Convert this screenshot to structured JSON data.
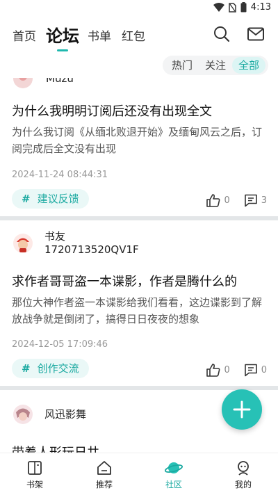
{
  "status_bar": {
    "time": "4:13"
  },
  "top_nav": {
    "tabs": [
      {
        "label": "首页"
      },
      {
        "label": "论坛"
      },
      {
        "label": "书单"
      },
      {
        "label": "红包"
      }
    ],
    "active_tab": "论坛",
    "icons": [
      "search-icon",
      "mail-icon"
    ]
  },
  "filter": {
    "items": [
      {
        "label": "热门"
      },
      {
        "label": "关注"
      },
      {
        "label": "全部"
      }
    ],
    "active": "全部"
  },
  "posts": [
    {
      "author": "Muzu",
      "title": "为什么我明明订阅后还没有出现全文",
      "body": "为什么我订阅《从缅北败退开始》及缅甸风云之后，订阅完成后全文没有出现",
      "time": "2024-11-24 08:44:31",
      "tag": "建议反馈",
      "likes": "0",
      "comments": "3"
    },
    {
      "author_line1": "书友",
      "author_line2": "1720713520QV1F",
      "title": "求作者哥哥盗一本谍影，作者是腾什么的",
      "body": "那位大神作者盗一本谍影给我们看看，这边谍影到了解放战争就是倒闭了，搞得日日夜夜的想象",
      "time": "2024-12-05 17:09:46",
      "tag": "创作交流",
      "likes": "0",
      "comments": "0"
    },
    {
      "author": "风迅影舞",
      "title": "带着人形玩日共"
    }
  ],
  "tag_prefix": "#",
  "bottom_nav": [
    {
      "label": "书架"
    },
    {
      "label": "推荐"
    },
    {
      "label": "社区"
    },
    {
      "label": "我的"
    }
  ],
  "colors": {
    "accent": "#1fb8ae",
    "fab": "#27c1b6",
    "separator": "#e3e6e8"
  }
}
